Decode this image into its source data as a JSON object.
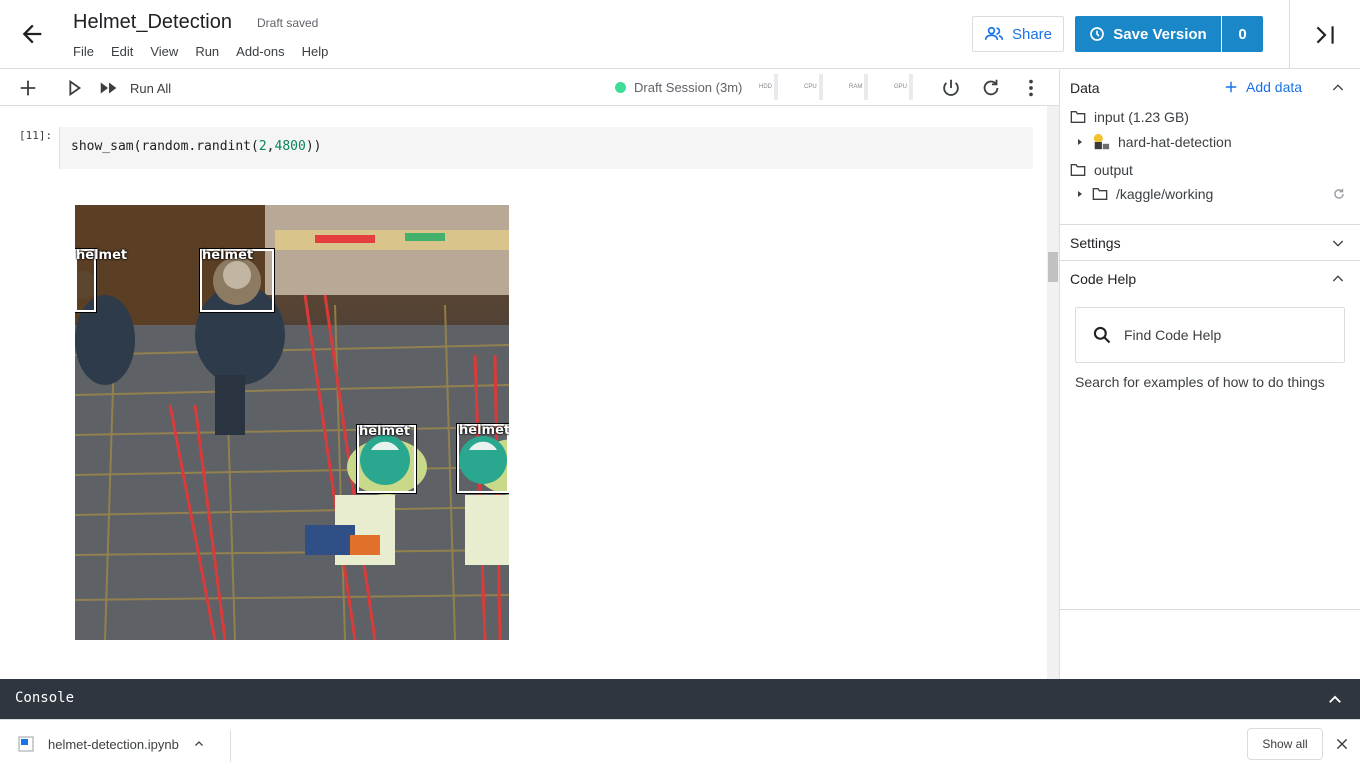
{
  "header": {
    "title": "Helmet_Detection",
    "draft_status": "Draft saved",
    "menu": [
      "File",
      "Edit",
      "View",
      "Run",
      "Add-ons",
      "Help"
    ],
    "share_label": "Share",
    "save_label": "Save Version",
    "version_count": "0"
  },
  "toolbar": {
    "run_all_label": "Run All",
    "session_label": "Draft Session (3m)",
    "gauges": [
      "HDD",
      "CPU",
      "RAM",
      "GPU"
    ]
  },
  "cell": {
    "prompt": "[11]:",
    "code_prefix": "show_sam(random.randint(",
    "code_arg1": "2",
    "code_comma": ",",
    "code_arg2": "4800",
    "code_suffix": "))"
  },
  "output": {
    "detections": [
      "helmet",
      "helmet",
      "helmet",
      "helmet"
    ]
  },
  "panel": {
    "data_title": "Data",
    "add_data_label": "Add data",
    "input_label": "input (1.23 GB)",
    "input_dataset": "hard-hat-detection",
    "output_label": "output",
    "output_path": "/kaggle/working",
    "settings_title": "Settings",
    "code_help_title": "Code Help",
    "search_placeholder": "Find Code Help",
    "search_hint": "Search for examples of how to do things"
  },
  "console": {
    "label": "Console"
  },
  "downloads": {
    "file_name": "helmet-detection.ipynb",
    "show_all_label": "Show all"
  },
  "colors": {
    "accent": "#1a87c9",
    "session_dot": "#3ddc97",
    "console_bg": "#2f3640"
  }
}
